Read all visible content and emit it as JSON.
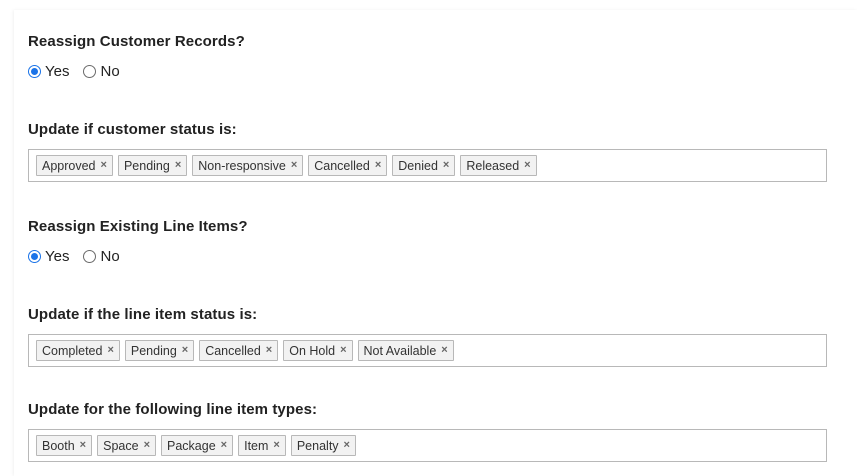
{
  "sections": {
    "reassign_customers": {
      "title": "Reassign Customer Records?",
      "options": [
        {
          "label": "Yes",
          "checked": true
        },
        {
          "label": "No",
          "checked": false
        }
      ]
    },
    "customer_status": {
      "title": "Update if customer status is:",
      "tags": [
        "Approved",
        "Pending",
        "Non-responsive",
        "Cancelled",
        "Denied",
        "Released"
      ]
    },
    "reassign_line_items": {
      "title": "Reassign Existing Line Items?",
      "options": [
        {
          "label": "Yes",
          "checked": true
        },
        {
          "label": "No",
          "checked": false
        }
      ]
    },
    "line_item_status": {
      "title": "Update if the line item status is:",
      "tags": [
        "Completed",
        "Pending",
        "Cancelled",
        "On Hold",
        "Not Available"
      ]
    },
    "line_item_types": {
      "title": "Update for the following line item types:",
      "tags": [
        "Booth",
        "Space",
        "Package",
        "Item",
        "Penalty"
      ]
    }
  },
  "icons": {
    "tag_remove": "×"
  },
  "colors": {
    "radio_selected": "#1a73e8",
    "tag_background": "#f2f2f2",
    "tag_border": "#b8b8b8"
  }
}
